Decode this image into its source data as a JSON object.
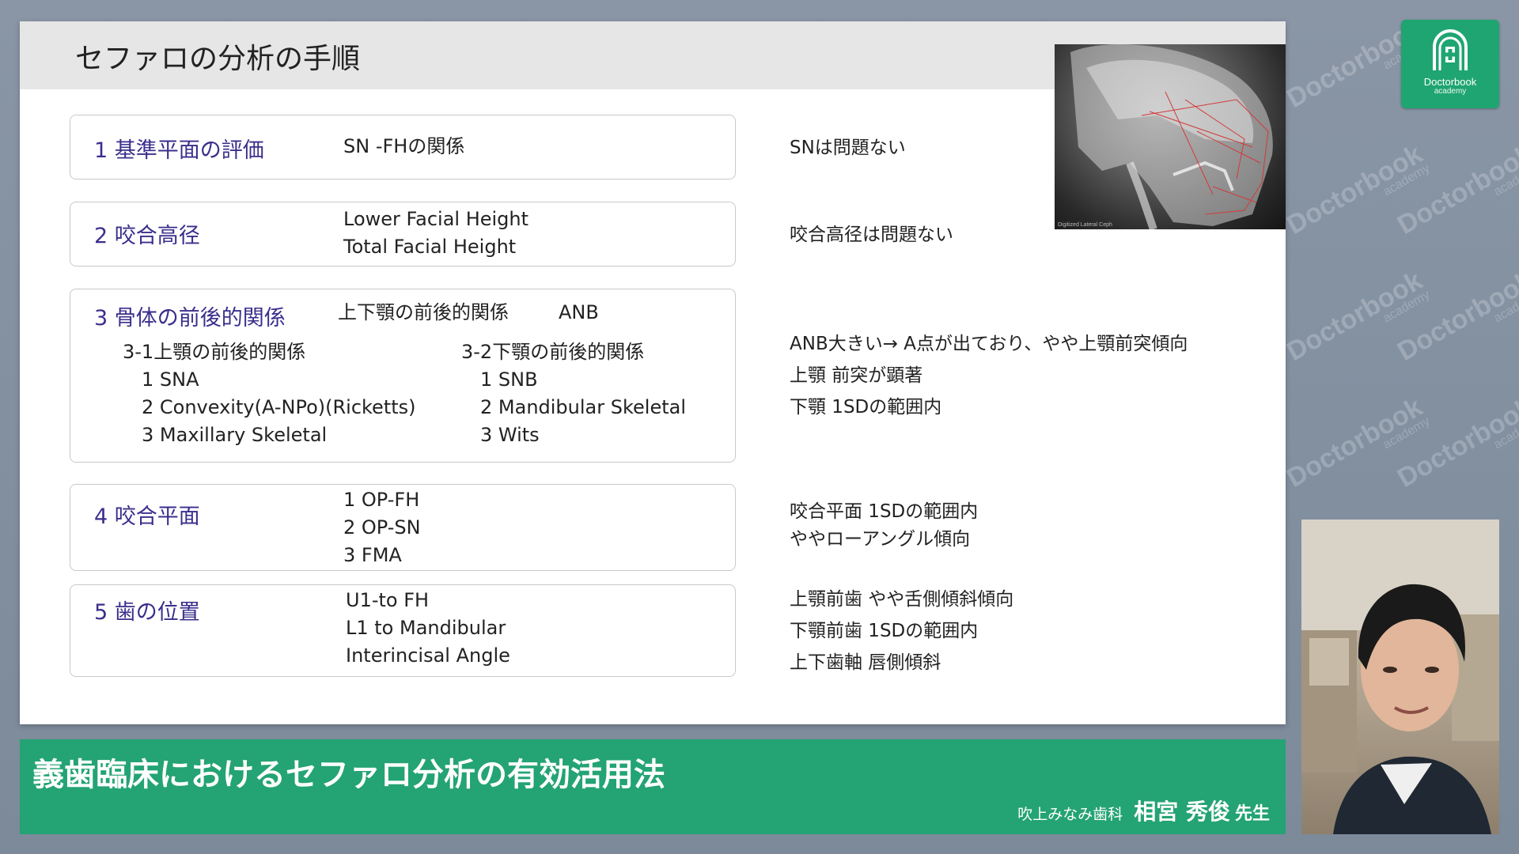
{
  "slide": {
    "title": "セファロの分析の手順",
    "xray_caption": "Digitized Lateral Ceph",
    "steps": [
      {
        "label": "1  基準平面の評価",
        "items": [
          "SN -FHの関係"
        ]
      },
      {
        "label": "2  咬合高径",
        "items": [
          "Lower Facial Height",
          "Total Facial Height"
        ]
      },
      {
        "label": "3  骨体の前後的関係",
        "inline_item": "上下顎の前後的関係",
        "inline_code": "ANB",
        "sub_left": {
          "heading": "3-1上顎の前後的関係",
          "items": [
            "1 SNA",
            "2 Convexity(A-NPo)(Ricketts)",
            "3 Maxillary Skeletal"
          ]
        },
        "sub_right": {
          "heading": "3-2下顎の前後的関係",
          "items": [
            "1 SNB",
            "2 Mandibular Skeletal",
            "3 Wits"
          ]
        }
      },
      {
        "label": "4  咬合平面",
        "items": [
          "1 OP-FH",
          "2 OP-SN",
          "3 FMA"
        ]
      },
      {
        "label": "5  歯の位置",
        "items": [
          "U1-to FH",
          "L1 to Mandibular",
          "Interincisal Angle"
        ]
      }
    ],
    "notes": {
      "step1": [
        "SNは問題ない"
      ],
      "step2": [
        "咬合高径は問題ない"
      ],
      "step3": [
        "ANB大きい→ A点が出ており、やや上顎前突傾向",
        "上顎 前突が顕著",
        " 下顎 1SDの範囲内"
      ],
      "step4": [
        "咬合平面  1SDの範囲内",
        "ややローアングル傾向"
      ],
      "step5": [
        "上顎前歯 やや舌側傾斜傾向",
        "下顎前歯 1SDの範囲内",
        "上下歯軸 唇側傾斜"
      ]
    }
  },
  "banner": {
    "title": "義歯臨床におけるセファロ分析の有効活用法",
    "clinic": "吹上みなみ歯科",
    "presenter": "相宮 秀俊",
    "honorific": "先生"
  },
  "logo": {
    "name": "Doctorbook",
    "sub": "academy"
  },
  "watermark": {
    "text": "Doctorbook",
    "sub": "academy"
  },
  "colors": {
    "brand_green": "#24a374",
    "step_purple": "#3a2f8c"
  }
}
